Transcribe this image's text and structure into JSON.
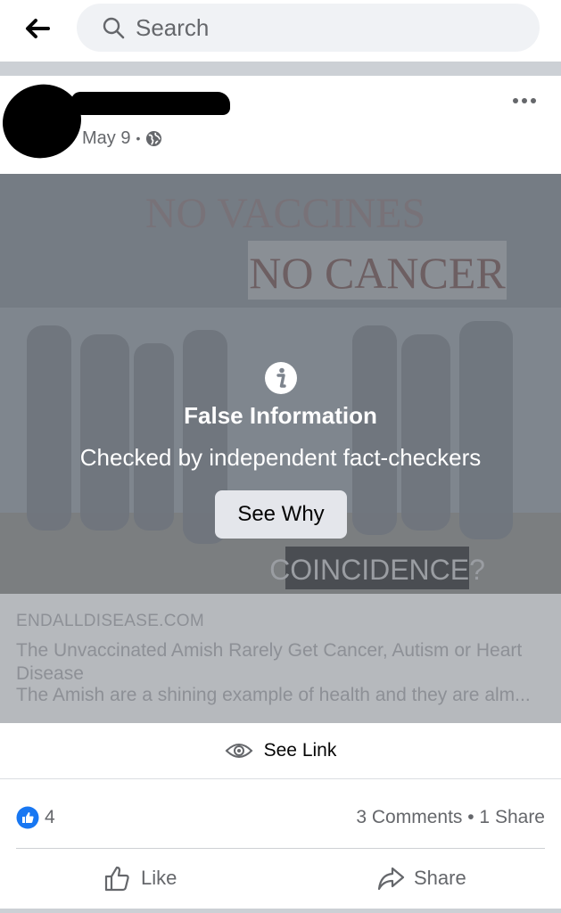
{
  "search": {
    "placeholder": "Search"
  },
  "post": {
    "date": "May 9",
    "separator": "•"
  },
  "media": {
    "image_text_top": "NO VACCINES",
    "image_text_mid": "NO CANCER",
    "image_text_bottom": "COINCIDENCE?",
    "warning_title": "False Information",
    "warning_subtitle": "Checked by independent fact-checkers",
    "see_why_label": "See Why"
  },
  "link_preview": {
    "domain": "ENDALLDISEASE.COM",
    "title": "The Unvaccinated Amish Rarely Get Cancer, Autism or Heart Disease",
    "description": "The Amish are a shining example of health and they are alm..."
  },
  "see_link": {
    "label": "See Link"
  },
  "stats": {
    "likes": "4",
    "comments_shares": "3 Comments • 1 Share"
  },
  "actions": {
    "like_label": "Like",
    "share_label": "Share"
  },
  "colors": {
    "accent_blue": "#1877f2",
    "overlay_gray": "#7d848d",
    "link_box_gray": "#b6b9bd"
  }
}
